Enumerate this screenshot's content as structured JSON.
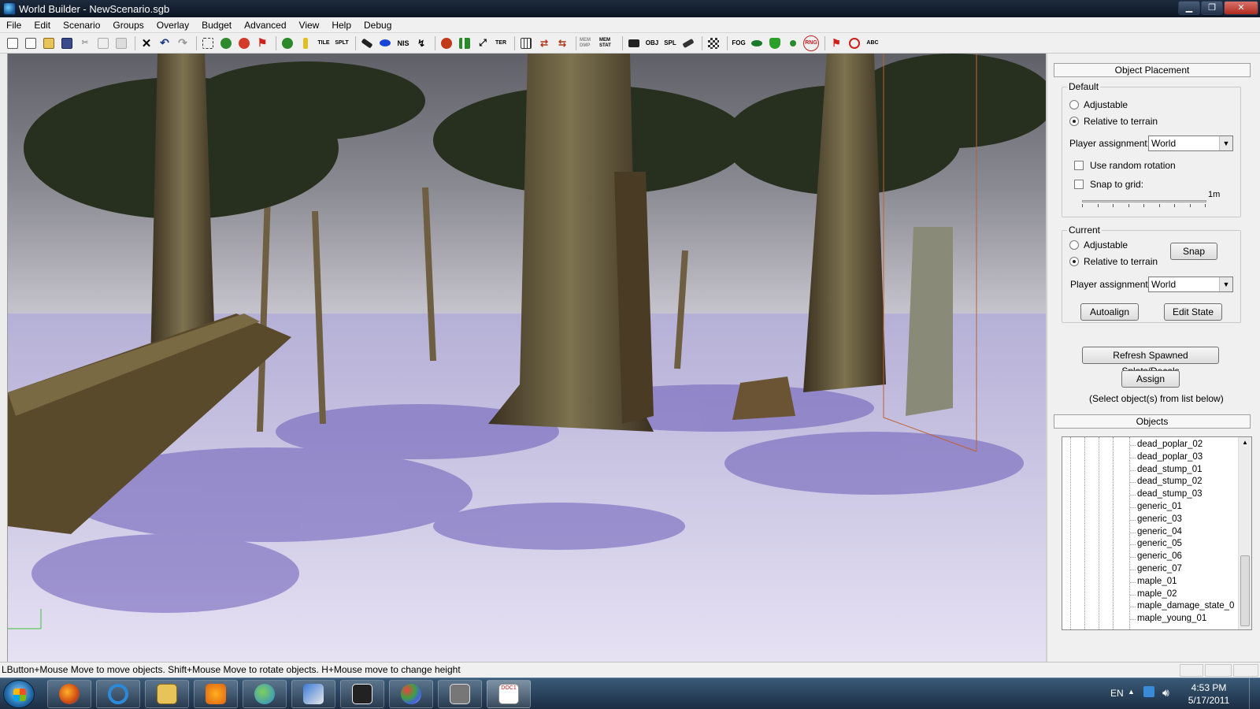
{
  "window": {
    "title": "World Builder - NewScenario.sgb",
    "controls": {
      "minimize": "▁",
      "maximize": "❐",
      "close": "✕"
    }
  },
  "menu": [
    "File",
    "Edit",
    "Scenario",
    "Groups",
    "Overlay",
    "Budget",
    "Advanced",
    "View",
    "Help",
    "Debug"
  ],
  "toolbar": {
    "text_buttons": {
      "tile": "TILE",
      "splt": "SPLT",
      "nis": "NIS",
      "ter": "TER",
      "memdmp": "MEM DMP",
      "memstat": "MEM STAT",
      "obj": "OBJ",
      "spl": "SPL",
      "fog": "FOG",
      "rng": "RNG",
      "abc": "ABC"
    }
  },
  "panel": {
    "object_placement": {
      "header": "Object Placement",
      "default": {
        "legend": "Default",
        "adjustable": "Adjustable",
        "relative_to_terrain": "Relative to terrain",
        "player_assignment_label": "Player assignment:",
        "player_assignment_value": "World",
        "use_random_rotation": "Use random rotation",
        "snap_to_grid": "Snap to grid:",
        "grid_value": "1m",
        "selected": "relative_to_terrain"
      },
      "current": {
        "legend": "Current",
        "adjustable": "Adjustable",
        "relative_to_terrain": "Relative to terrain",
        "snap_button": "Snap",
        "player_assignment_label": "Player assignment:",
        "player_assignment_value": "World",
        "autoalign_button": "Autoalign",
        "edit_state_button": "Edit State",
        "selected": "relative_to_terrain"
      },
      "refresh_button": "Refresh Spawned Splats/Decals",
      "assign_button": "Assign",
      "assign_hint": "(Select object(s) from list below)"
    },
    "objects": {
      "header": "Objects",
      "items": [
        "dead_poplar_02",
        "dead_poplar_03",
        "dead_stump_01",
        "dead_stump_02",
        "dead_stump_03",
        "generic_01",
        "generic_03",
        "generic_04",
        "generic_05",
        "generic_06",
        "generic_07",
        "maple_01",
        "maple_02",
        "maple_damage_state_0",
        "maple_young_01"
      ]
    }
  },
  "status": {
    "message": "LButton+Mouse Move to move objects. Shift+Mouse Move to rotate objects. H+Mouse move to change height"
  },
  "taskbar": {
    "language": "EN",
    "time": "4:53 PM",
    "date": "5/17/2011",
    "doc_label": "DOC1"
  },
  "colors": {
    "snow": "#c9c3e2",
    "sky": "#8e8e98",
    "bark": "#5a4a2c",
    "foliage": "#2c3320"
  }
}
